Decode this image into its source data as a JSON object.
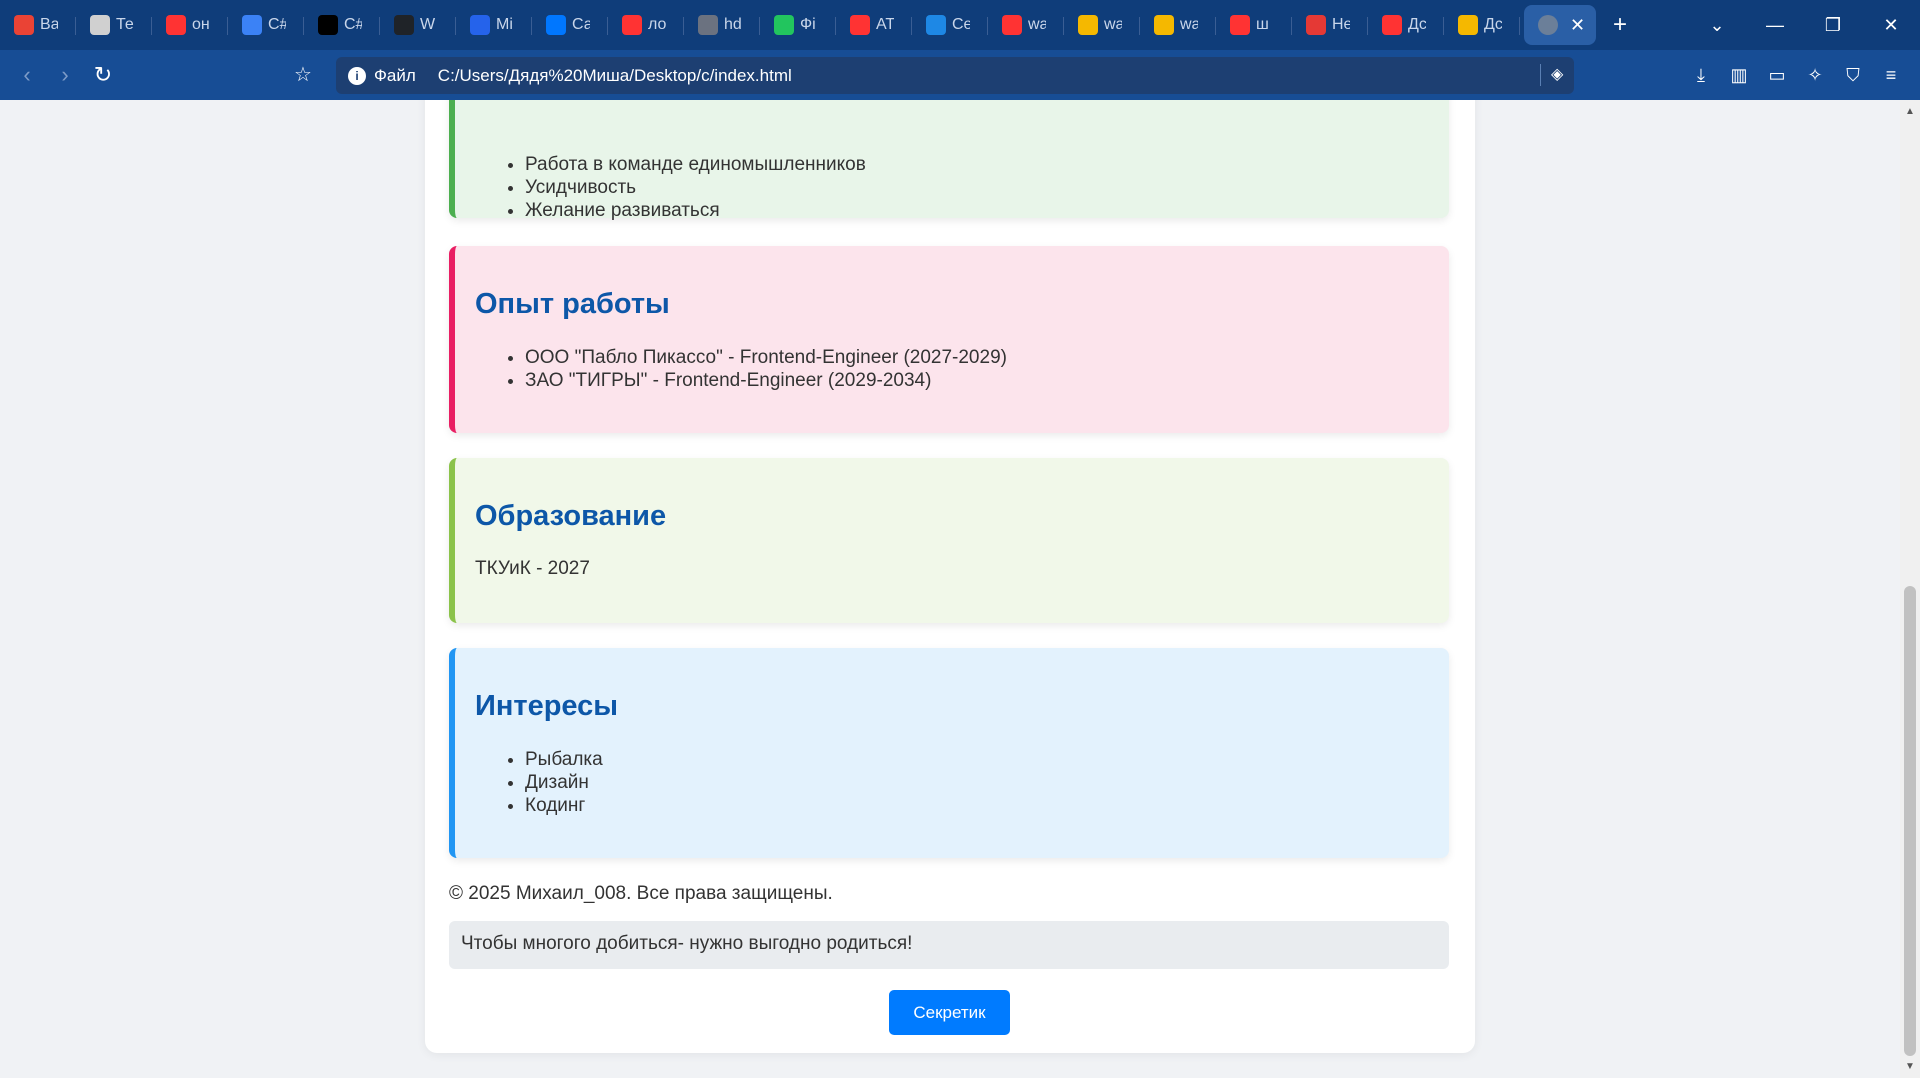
{
  "browser": {
    "tabs": [
      {
        "title": "Ва",
        "icon": "gmail-icon",
        "color": "#ea4335"
      },
      {
        "title": "Те",
        "icon": "doc-icon",
        "color": "#d0d0d0"
      },
      {
        "title": "он",
        "icon": "yandex-icon",
        "color": "#f33"
      },
      {
        "title": "C#",
        "icon": "csharp-icon",
        "color": "#3b82f6"
      },
      {
        "title": "C#",
        "icon": "n-icon",
        "color": "#000000"
      },
      {
        "title": "W",
        "icon": "github-icon",
        "color": "#1f2328"
      },
      {
        "title": "Mi",
        "icon": "chat-icon",
        "color": "#2563eb"
      },
      {
        "title": "Са",
        "icon": "vk-icon",
        "color": "#0077ff"
      },
      {
        "title": "ло",
        "icon": "yandex-icon",
        "color": "#f33"
      },
      {
        "title": "hd",
        "icon": "hd-icon",
        "color": "#6b7280"
      },
      {
        "title": "Фі",
        "icon": "hd-green-icon",
        "color": "#22c55e"
      },
      {
        "title": "АТ",
        "icon": "yandex-icon",
        "color": "#f33"
      },
      {
        "title": "Се",
        "icon": "frame-icon",
        "color": "#1e88e5"
      },
      {
        "title": "wa",
        "icon": "yandex-icon",
        "color": "#f33"
      },
      {
        "title": "wa",
        "icon": "image-icon",
        "color": "#f5b800"
      },
      {
        "title": "wa",
        "icon": "image-icon",
        "color": "#f5b800"
      },
      {
        "title": "ш",
        "icon": "yandex-icon",
        "color": "#f33"
      },
      {
        "title": "Не",
        "icon": "shield-red-icon",
        "color": "#e53935"
      },
      {
        "title": "Дс",
        "icon": "yandex-icon",
        "color": "#f33"
      },
      {
        "title": "Дс",
        "icon": "image-icon",
        "color": "#f5b800"
      }
    ],
    "address": {
      "label": "Файл",
      "url": "C:/Users/Дядя%20Миша/Desktop/c/index.html"
    }
  },
  "page": {
    "skills": {
      "items": [
        "Работа в команде единомышленников",
        "Усидчивость",
        "Желание развиваться"
      ],
      "border_color": "#4caf50"
    },
    "work": {
      "title": "Опыт работы",
      "items": [
        "ООО \"Пабло Пикассо\" - Frontend-Engineer (2027-2029)",
        "ЗАО \"ТИГРЫ\" - Frontend-Engineer (2029-2034)"
      ],
      "border_color": "#e91e63"
    },
    "education": {
      "title": "Образование",
      "text": "ТКУиК - 2027",
      "border_color": "#8bc34a"
    },
    "interests": {
      "title": "Интересы",
      "items": [
        "Рыбалка",
        "Дизайн",
        "Кодинг"
      ],
      "border_color": "#2196f3"
    },
    "copyright": "© 2025 Михаил_008. Все права защищены.",
    "quote": "Чтобы многого добиться- нужно выгодно родиться!",
    "button": "Секретик",
    "heading_color": "#0d57a8",
    "button_color": "#007bff"
  }
}
